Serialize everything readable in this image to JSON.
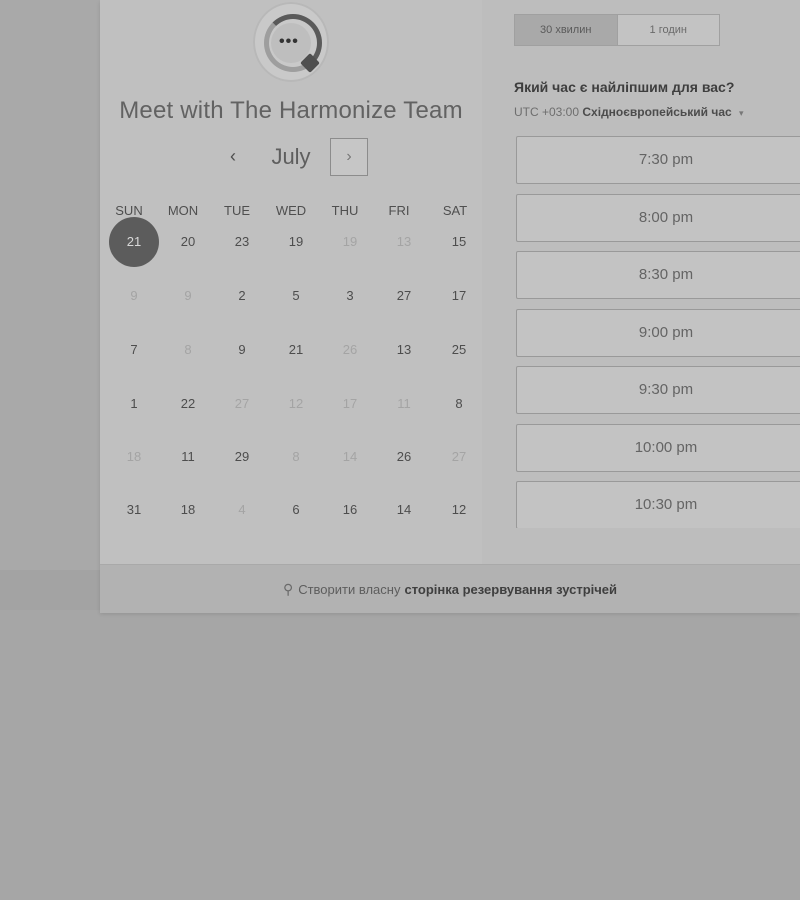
{
  "widget": {
    "title": "Meet with The Harmonize Team",
    "month": "July",
    "prev_icon": "‹",
    "next_icon": "›",
    "weekdays": [
      "SUN",
      "MON",
      "TUE",
      "WED",
      "THU",
      "FRI",
      "SAT"
    ],
    "weeks": [
      [
        {
          "d": "21",
          "s": "selected"
        },
        {
          "d": "20",
          "s": "active"
        },
        {
          "d": "23",
          "s": "active"
        },
        {
          "d": "19",
          "s": "active"
        },
        {
          "d": "19",
          "s": "dim"
        },
        {
          "d": "13",
          "s": "dim"
        },
        {
          "d": "15",
          "s": "active"
        }
      ],
      [
        {
          "d": "9",
          "s": "dim"
        },
        {
          "d": "9",
          "s": "dim"
        },
        {
          "d": "2",
          "s": "active"
        },
        {
          "d": "5",
          "s": "active"
        },
        {
          "d": "3",
          "s": "active"
        },
        {
          "d": "27",
          "s": "active"
        },
        {
          "d": "17",
          "s": "active"
        }
      ],
      [
        {
          "d": "7",
          "s": "active"
        },
        {
          "d": "8",
          "s": "dim"
        },
        {
          "d": "9",
          "s": "active"
        },
        {
          "d": "21",
          "s": "active"
        },
        {
          "d": "26",
          "s": "dim"
        },
        {
          "d": "13",
          "s": "active"
        },
        {
          "d": "25",
          "s": "active"
        }
      ],
      [
        {
          "d": "1",
          "s": "active"
        },
        {
          "d": "22",
          "s": "active"
        },
        {
          "d": "27",
          "s": "dim"
        },
        {
          "d": "12",
          "s": "dim"
        },
        {
          "d": "17",
          "s": "dim"
        },
        {
          "d": "11",
          "s": "dim"
        },
        {
          "d": "8",
          "s": "active"
        }
      ],
      [
        {
          "d": "18",
          "s": "dim"
        },
        {
          "d": "11",
          "s": "active"
        },
        {
          "d": "29",
          "s": "active"
        },
        {
          "d": "8",
          "s": "dim"
        },
        {
          "d": "14",
          "s": "dim"
        },
        {
          "d": "26",
          "s": "active"
        },
        {
          "d": "27",
          "s": "dim"
        }
      ],
      [
        {
          "d": "31",
          "s": "active"
        },
        {
          "d": "18",
          "s": "active"
        },
        {
          "d": "4",
          "s": "dim"
        },
        {
          "d": "6",
          "s": "active"
        },
        {
          "d": "16",
          "s": "active"
        },
        {
          "d": "14",
          "s": "active"
        },
        {
          "d": "12",
          "s": "active"
        }
      ]
    ]
  },
  "booking": {
    "durations": [
      {
        "label": "30 хвилин",
        "active": true
      },
      {
        "label": "1 годин",
        "active": false
      }
    ],
    "question": "Який час є найліпшим для вас?",
    "timezone_offset": "UTC +03:00",
    "timezone_name": "Східноєвропейський час",
    "timezone_caret": "▾",
    "slots": [
      "7:30 pm",
      "8:00 pm",
      "8:30 pm",
      "9:00 pm",
      "9:30 pm",
      "10:00 pm",
      "10:30 pm"
    ]
  },
  "footer": {
    "icon": "hubspot-icon",
    "icon_glyph": "⚲",
    "text": "Створити власну",
    "link": "сторінка резервування зустрічей"
  }
}
